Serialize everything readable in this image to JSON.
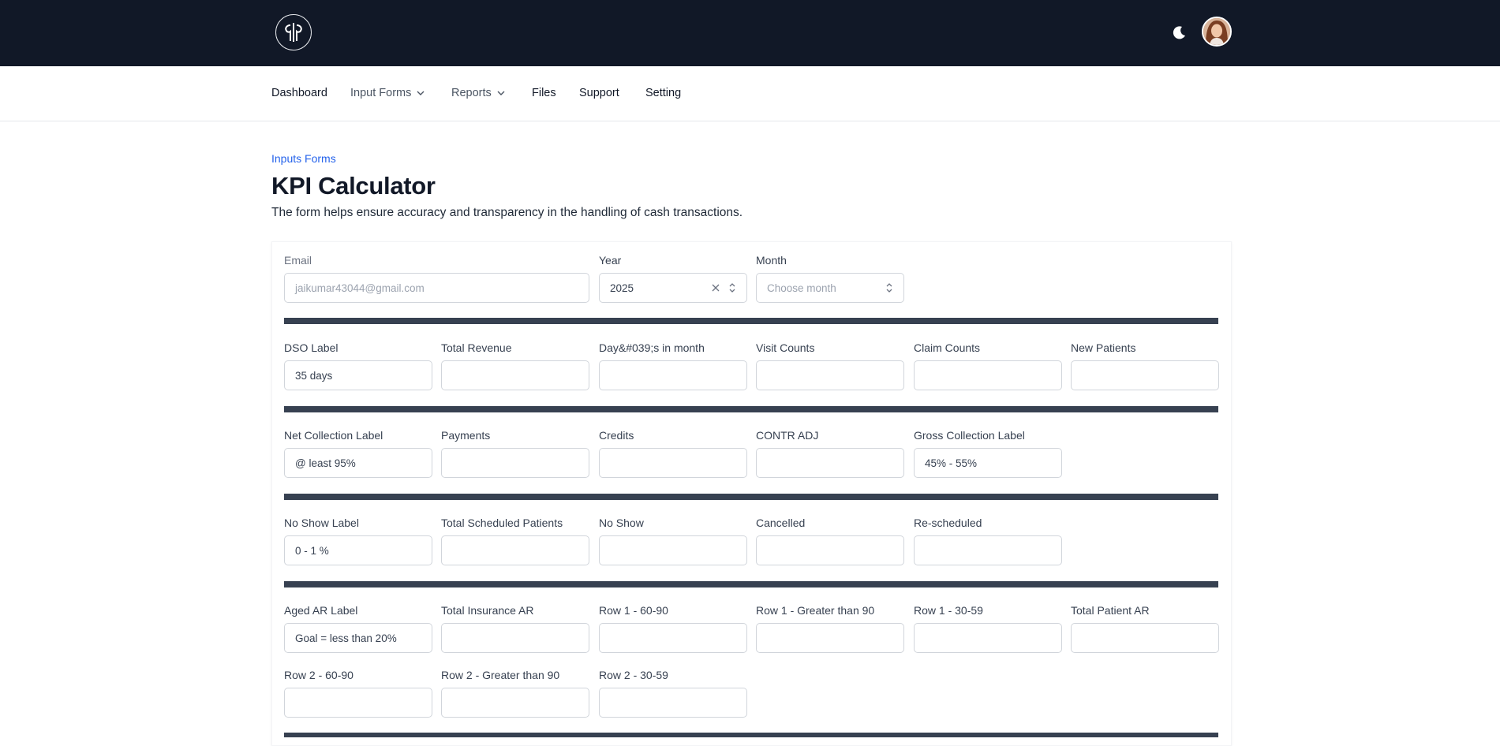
{
  "nav": {
    "dashboard": "Dashboard",
    "input_forms": "Input Forms",
    "reports": "Reports",
    "files": "Files",
    "support": "Support",
    "setting": "Setting"
  },
  "header": {
    "breadcrumb": "Inputs Forms",
    "title": "KPI Calculator",
    "description": "The form helps ensure accuracy and transparency in the handling of cash transactions."
  },
  "form": {
    "email": {
      "label": "Email",
      "value": "jaikumar43044@gmail.com"
    },
    "year": {
      "label": "Year",
      "value": "2025"
    },
    "month": {
      "label": "Month",
      "placeholder": "Choose month"
    },
    "dso": {
      "label": "DSO Label",
      "value": "35 days",
      "total_revenue": "Total Revenue",
      "days_in_month": "Day&#039;s in month",
      "visit_counts": "Visit Counts",
      "claim_counts": "Claim Counts",
      "new_patients": "New Patients"
    },
    "net_collection": {
      "label": "Net Collection Label",
      "value": "@ least 95%",
      "payments": "Payments",
      "credits": "Credits",
      "contr_adj": "CONTR ADJ",
      "gross_label": "Gross Collection Label",
      "gross_value": "45% - 55%"
    },
    "no_show": {
      "label": "No Show Label",
      "value": "0 - 1 %",
      "total_scheduled": "Total Scheduled Patients",
      "no_show": "No Show",
      "cancelled": "Cancelled",
      "rescheduled": "Re-scheduled"
    },
    "aged_ar": {
      "label": "Aged AR Label",
      "value": "Goal = less than 20%",
      "total_insurance_ar": "Total Insurance AR",
      "row1_60_90": "Row 1 - 60-90",
      "row1_gt_90": "Row 1 - Greater than 90",
      "row1_30_59": "Row 1 - 30-59",
      "total_patient_ar": "Total Patient AR",
      "row2_60_90": "Row 2 - 60-90",
      "row2_gt_90": "Row 2 - Greater than 90",
      "row2_30_59": "Row 2 - 30-59"
    }
  },
  "icons": {
    "logo": "logo-icon",
    "theme": "moon-icon",
    "chevron": "chevron-down-icon",
    "clear": "close-icon",
    "select": "chevron-up-down-icon"
  },
  "colors": {
    "topbar": "#111827",
    "accent": "#2563eb",
    "divider": "#374151"
  }
}
